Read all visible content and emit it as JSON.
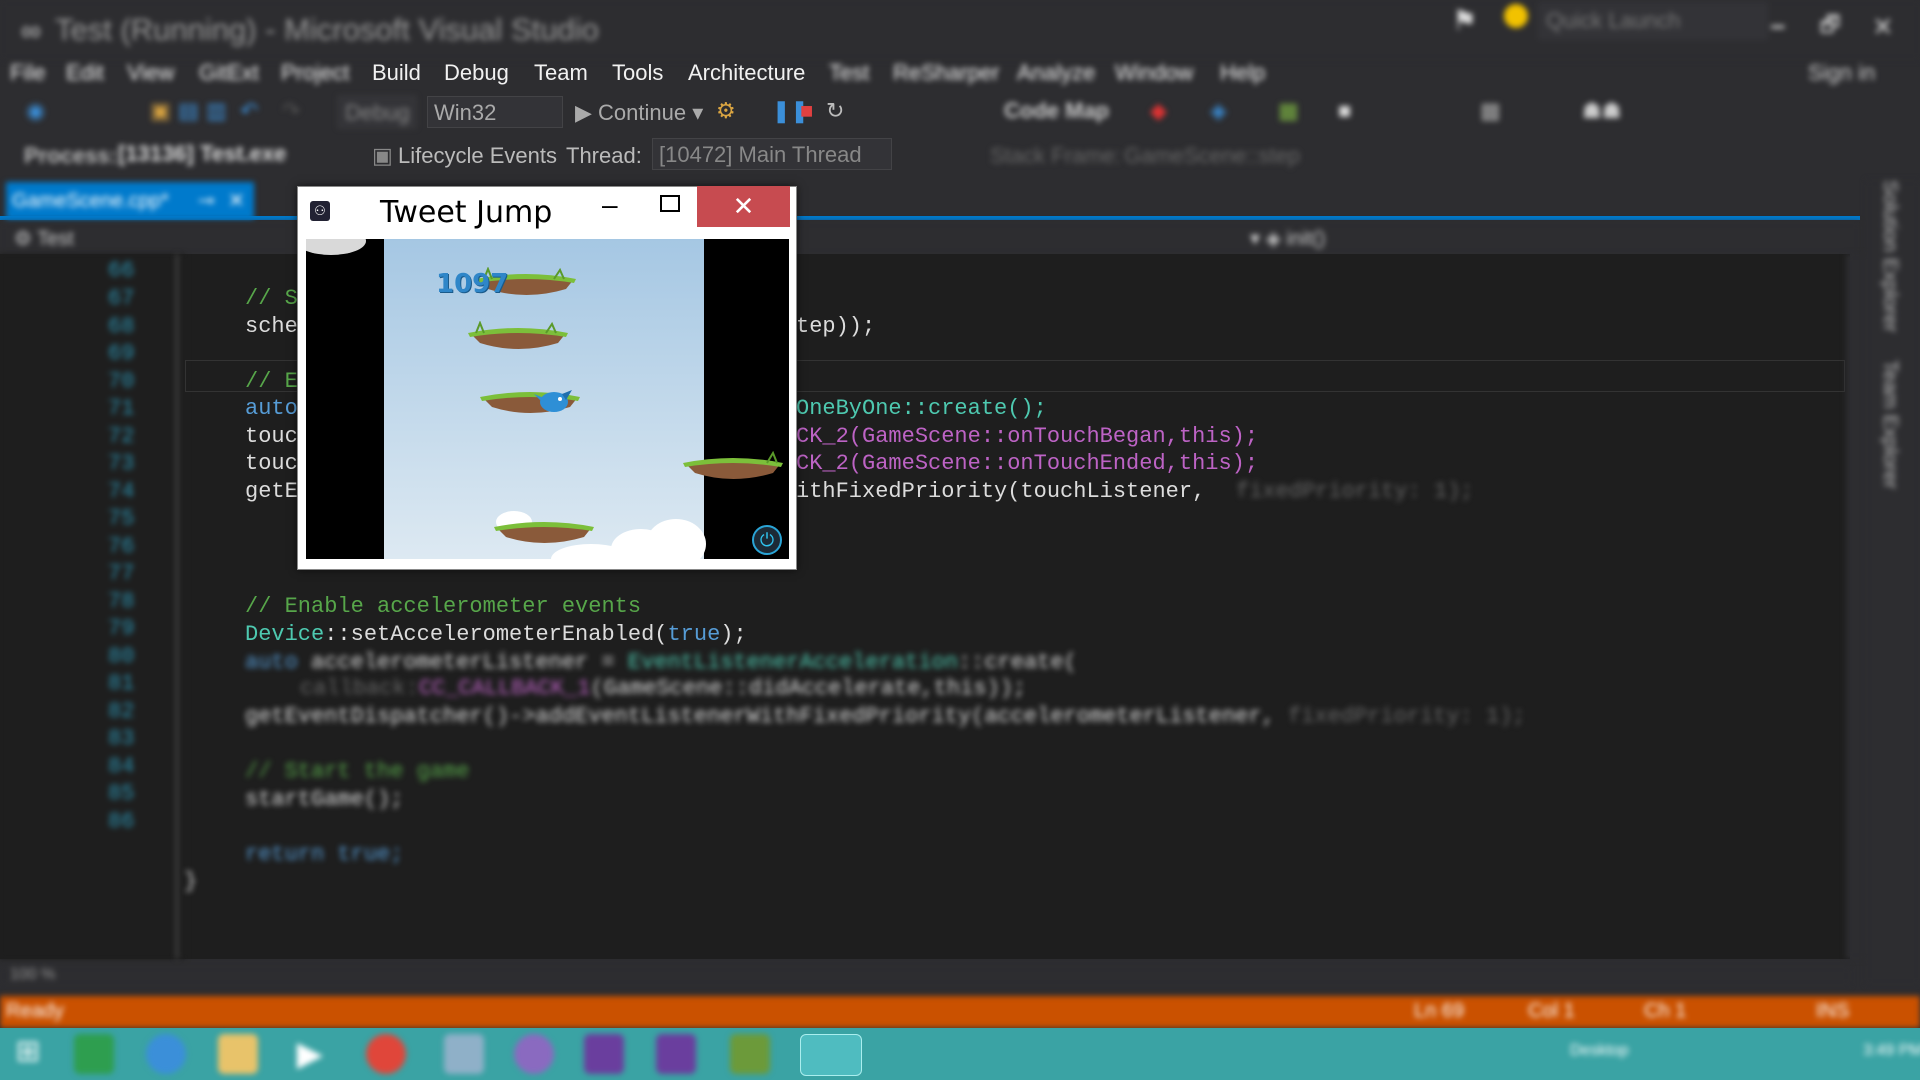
{
  "window": {
    "title": "Test (Running) - Microsoft Visual Studio",
    "quick_launch": "Quick Launch",
    "buttons": "🗕 🗗 🗙"
  },
  "menu": [
    "File",
    "Edit",
    "View",
    "GitExt",
    "Project",
    "Build",
    "Debug",
    "Team",
    "Tools",
    "Architecture",
    "Test",
    "ReSharper",
    "Analyze",
    "Window",
    "Help"
  ],
  "sign_in": "Sign in",
  "toolbar": {
    "config": "Debug",
    "platform": "Win32",
    "continue": "Continue",
    "code_map": "Code Map"
  },
  "debug_location": {
    "process_label": "Process:",
    "process": "[13136] Test.exe",
    "lifecycle": "Lifecycle Events",
    "thread_label": "Thread:",
    "thread": "[10472] Main Thread",
    "stack_frame_label": "Stack Frame:",
    "stack_frame": "GameScene::step"
  },
  "doc_tab": {
    "label": "GameScene.cpp*"
  },
  "nav": {
    "project": "Test",
    "member": "init()"
  },
  "editor": {
    "line_numbers": [
      "66",
      "67",
      "68",
      "69",
      "70",
      "71",
      "72",
      "73",
      "74",
      "75",
      "76",
      "77",
      "78",
      "79",
      "80",
      "81",
      "82",
      "83",
      "84",
      "85",
      "86"
    ],
    "lines": {
      "l67": "// S",
      "l68a": "sche",
      "l68b": "tep));",
      "l70": "// E",
      "l71a": "auto",
      "l71b": "OneByOne::create();",
      "l72a": "touc",
      "l72b": "CK_2(GameScene::onTouchBegan,this);",
      "l73a": "touc",
      "l73b": "CK_2(GameScene::onTouchEnded,this);",
      "l74a": "getE",
      "l74b": "ithFixedPriority(touchListener,",
      "l74c": "fixedPriority: 1);",
      "l76": "// Enable accelerometer events",
      "l77a": "Device",
      "l77b": "::setAccelerometerEnabled(",
      "l77c": "true",
      "l77d": ");",
      "l78a": "auto",
      "l78b": "accelerometerListener = ",
      "l78c": "EventListenerAcceleration",
      "l78d": "::create(",
      "l79a": "callback:",
      "l79b": "CC_CALLBACK_1",
      "l79c": "(GameScene::didAccelerate,this));",
      "l80a": "getEventDispatcher()->addEventListenerWithFixedPriority(accelerometerListener,",
      "l80b": "fixedPriority: 1);",
      "l82": "// Start the game",
      "l83": "startGame();",
      "l85a": "return",
      "l85b": "true;",
      "l86": "}"
    },
    "zoom": "100 %"
  },
  "side_tabs": [
    "Solution Explorer",
    "Team Explorer"
  ],
  "status": {
    "state": "Ready",
    "ln": "Ln 69",
    "col": "Col 1",
    "ch": "Ch 1",
    "ins": "INS"
  },
  "tray": {
    "label": "Desktop",
    "time": "3:49 PM"
  },
  "game": {
    "title": "Tweet Jump",
    "close": "✕",
    "score": "1097"
  },
  "colors": {
    "accent": "#007acc",
    "status": "#ca5100",
    "close_button": "#c74b50",
    "taskbar": "#3aa3a4"
  }
}
